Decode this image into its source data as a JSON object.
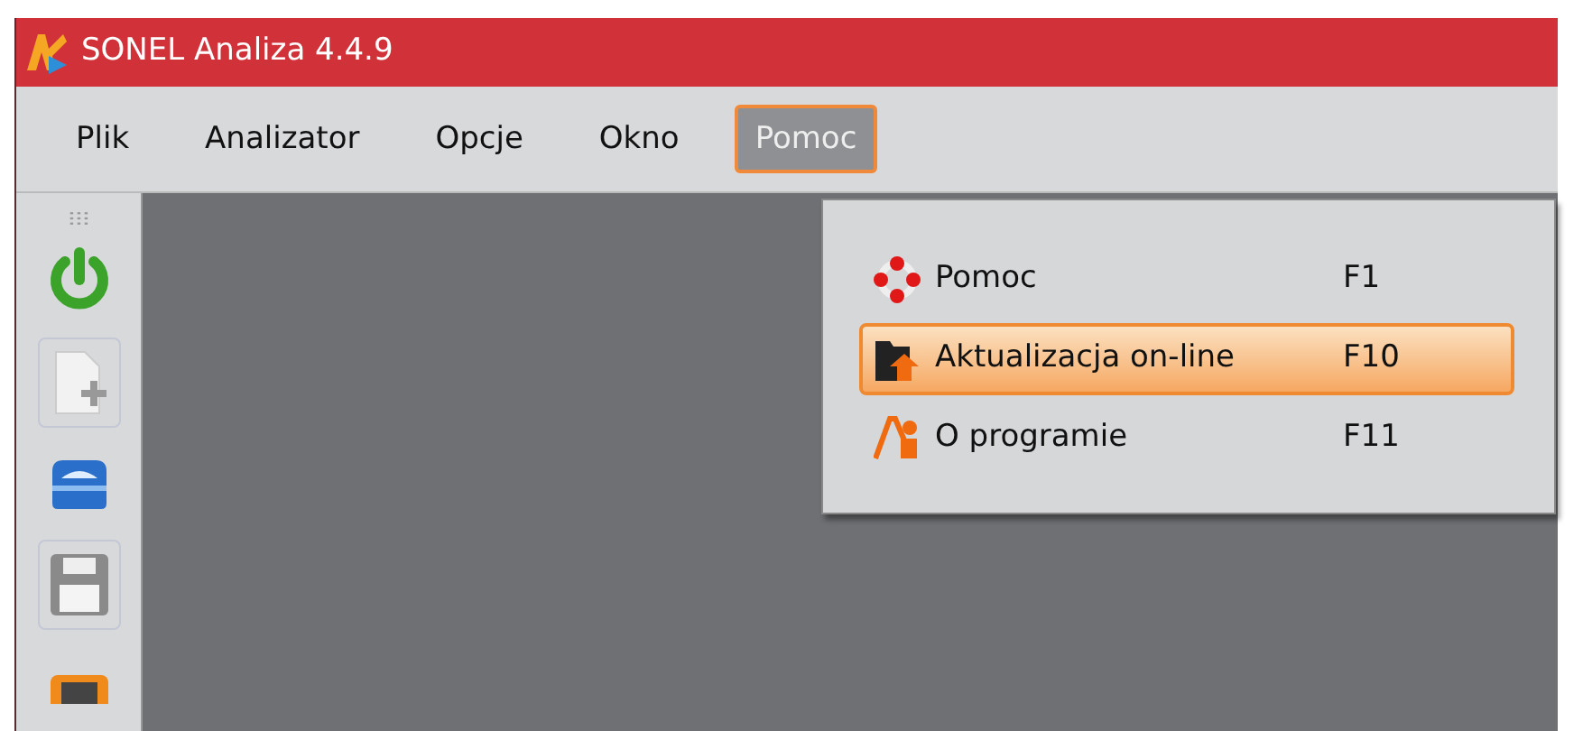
{
  "window": {
    "title": "SONEL Analiza 4.4.9"
  },
  "menu_bar": [
    {
      "label": "Plik",
      "selected": false
    },
    {
      "label": "Analizator",
      "selected": false
    },
    {
      "label": "Opcje",
      "selected": false
    },
    {
      "label": "Okno",
      "selected": false
    },
    {
      "label": "Pomoc",
      "selected": true
    }
  ],
  "toolbar": [
    {
      "kind": "power",
      "disabled": false
    },
    {
      "kind": "new",
      "disabled": true
    },
    {
      "kind": "open",
      "disabled": false
    },
    {
      "kind": "save",
      "disabled": true
    },
    {
      "kind": "device",
      "disabled": false
    }
  ],
  "dropdown": [
    {
      "kind": "help",
      "label": "Pomoc",
      "shortcut": "F1",
      "selected": false
    },
    {
      "kind": "update",
      "label": "Aktualizacja on-line",
      "shortcut": "F10",
      "selected": true
    },
    {
      "kind": "about",
      "label": "O programie",
      "shortcut": "F11",
      "selected": false
    }
  ]
}
